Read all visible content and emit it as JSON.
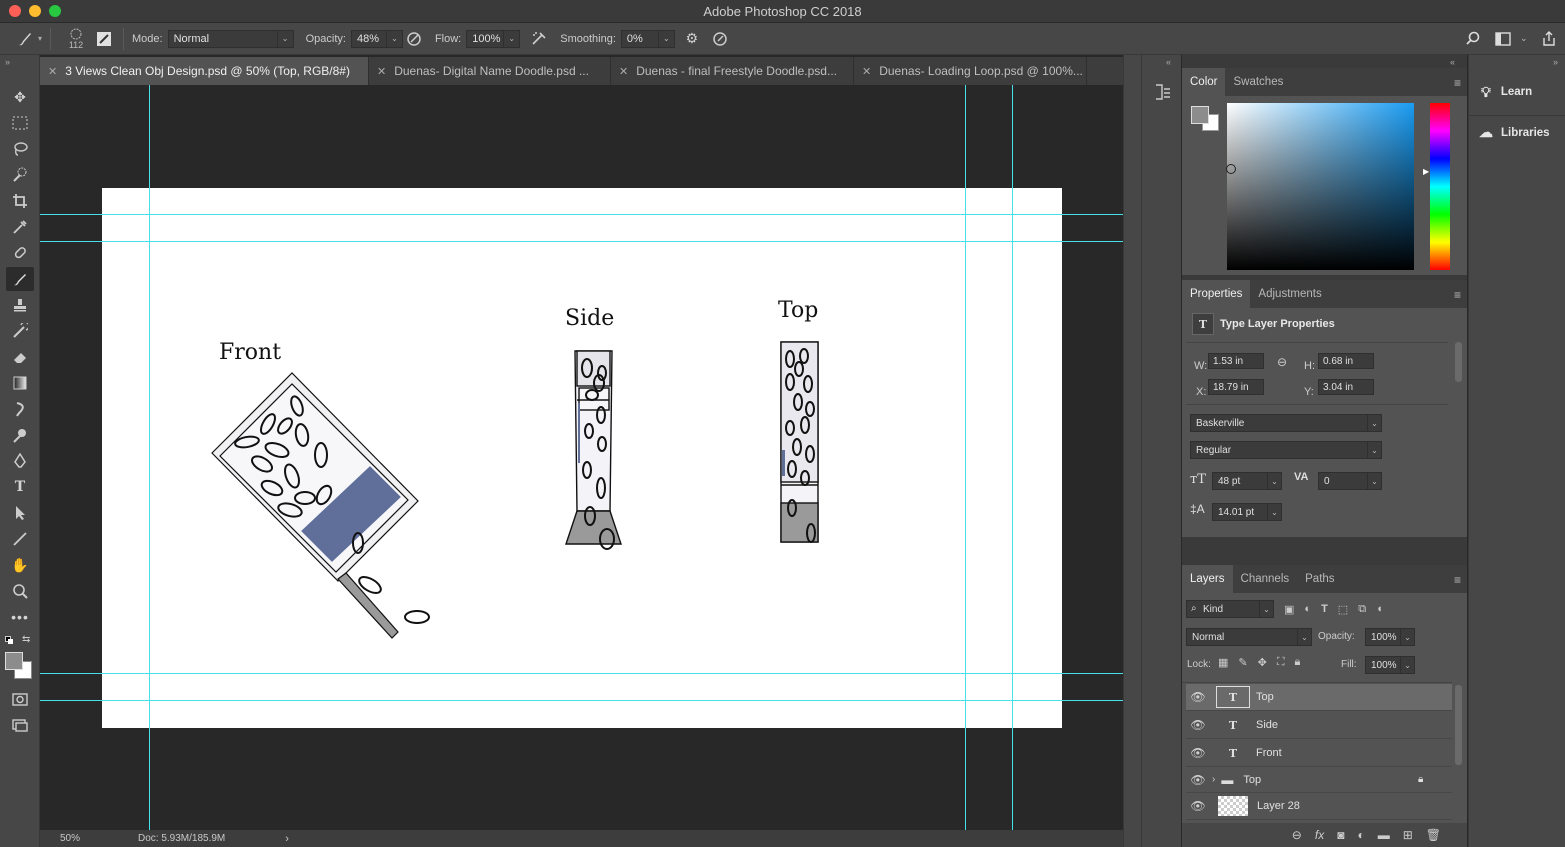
{
  "app": {
    "title": "Adobe Photoshop CC 2018"
  },
  "options_bar": {
    "brush_size": "112",
    "mode_label": "Mode:",
    "mode_value": "Normal",
    "opacity_label": "Opacity:",
    "opacity_value": "48%",
    "flow_label": "Flow:",
    "flow_value": "100%",
    "smoothing_label": "Smoothing:",
    "smoothing_value": "0%"
  },
  "tabs": [
    {
      "label": "3 Views Clean Obj Design.psd @ 50% (Top, RGB/8#)",
      "active": true
    },
    {
      "label": "Duenas- Digital Name Doodle.psd ...",
      "active": false
    },
    {
      "label": "Duenas - final Freestyle Doodle.psd...",
      "active": false
    },
    {
      "label": "Duenas- Loading Loop.psd @ 100%...",
      "active": false
    }
  ],
  "canvas": {
    "labels": {
      "front": "Front",
      "side": "Side",
      "top": "Top"
    }
  },
  "status": {
    "zoom": "50%",
    "doc": "Doc: 5.93M/185.9M"
  },
  "color_panel": {
    "tabs": [
      "Color",
      "Swatches"
    ]
  },
  "properties_panel": {
    "tabs": [
      "Properties",
      "Adjustments"
    ],
    "header": "Type Layer Properties",
    "w_label": "W:",
    "w_value": "1.53 in",
    "h_label": "H:",
    "h_value": "0.68 in",
    "x_label": "X:",
    "x_value": "18.79 in",
    "y_label": "Y:",
    "y_value": "3.04 in",
    "font_family": "Baskerville",
    "font_style": "Regular",
    "font_size": "48 pt",
    "tracking": "0",
    "leading": "14.01 pt"
  },
  "layers_panel": {
    "tabs": [
      "Layers",
      "Channels",
      "Paths"
    ],
    "filter": "Kind",
    "blend_mode": "Normal",
    "opacity_label": "Opacity:",
    "opacity_value": "100%",
    "lock_label": "Lock:",
    "fill_label": "Fill:",
    "fill_value": "100%",
    "layers": [
      {
        "name": "Top",
        "kind": "text",
        "selected": true
      },
      {
        "name": "Side",
        "kind": "text",
        "selected": false
      },
      {
        "name": "Front",
        "kind": "text",
        "selected": false
      },
      {
        "name": "Top",
        "kind": "group",
        "selected": false
      },
      {
        "name": "Layer 28",
        "kind": "pixel",
        "selected": false
      }
    ]
  },
  "right_dock": {
    "learn": "Learn",
    "libraries": "Libraries"
  },
  "colors": {
    "foreground": "#8c8c8c",
    "background": "#ffffff",
    "guide": "#46e0e8",
    "sketch_blue": "#5f6f9a"
  }
}
